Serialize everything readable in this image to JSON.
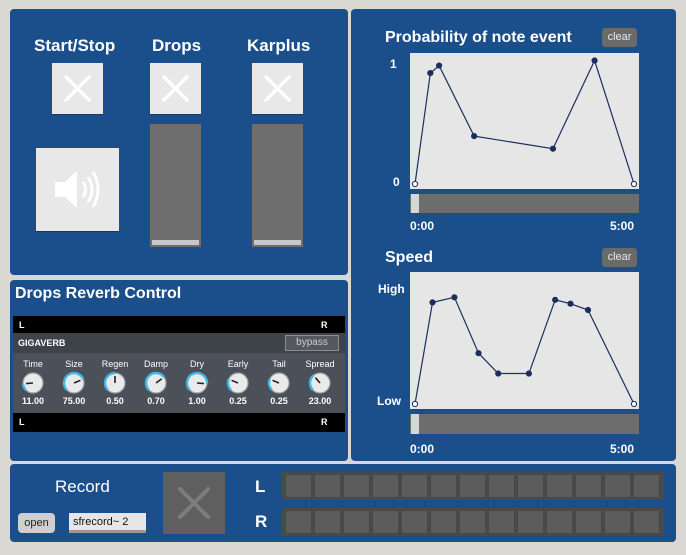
{
  "controls": {
    "start_stop_label": "Start/Stop",
    "drops_label": "Drops",
    "karplus_label": "Karplus"
  },
  "reverb": {
    "title": "Drops Reverb Control",
    "top_left": "L",
    "top_right": "R",
    "bottom_left": "L",
    "bottom_right": "R",
    "plugin_name": "GIGAVERB",
    "bypass_label": "bypass",
    "dials": [
      {
        "label": "Time",
        "value": "11.00",
        "level": 0.15
      },
      {
        "label": "Size",
        "value": "75.00",
        "level": 0.75
      },
      {
        "label": "Regen",
        "value": "0.50",
        "level": 0.5
      },
      {
        "label": "Damp",
        "value": "0.70",
        "level": 0.7
      },
      {
        "label": "Dry",
        "value": "1.00",
        "level": 0.85
      },
      {
        "label": "Early",
        "value": "0.25",
        "level": 0.25
      },
      {
        "label": "Tail",
        "value": "0.25",
        "level": 0.25
      },
      {
        "label": "Spread",
        "value": "23.00",
        "level": 0.35
      }
    ]
  },
  "probability": {
    "title": "Probability of note event",
    "clear_label": "clear",
    "y_top": "1",
    "y_bottom": "0",
    "x_start": "0:00",
    "x_end": "5:00",
    "points": [
      [
        0.0,
        0.0
      ],
      [
        0.07,
        0.88
      ],
      [
        0.11,
        0.94
      ],
      [
        0.27,
        0.38
      ],
      [
        0.63,
        0.28
      ],
      [
        0.82,
        0.98
      ],
      [
        1.0,
        0.0
      ]
    ]
  },
  "speed": {
    "title": "Speed",
    "clear_label": "clear",
    "y_top": "High",
    "y_bottom": "Low",
    "x_start": "0:00",
    "x_end": "5:00",
    "points": [
      [
        0.0,
        0.0
      ],
      [
        0.08,
        0.8
      ],
      [
        0.18,
        0.84
      ],
      [
        0.29,
        0.4
      ],
      [
        0.38,
        0.24
      ],
      [
        0.52,
        0.24
      ],
      [
        0.64,
        0.82
      ],
      [
        0.71,
        0.79
      ],
      [
        0.79,
        0.74
      ],
      [
        1.0,
        0.0
      ]
    ]
  },
  "record": {
    "title": "Record",
    "open_label": "open",
    "object_label": "sfrecord~ 2",
    "meter_l": "L",
    "meter_r": "R",
    "meter_segments": 13
  }
}
